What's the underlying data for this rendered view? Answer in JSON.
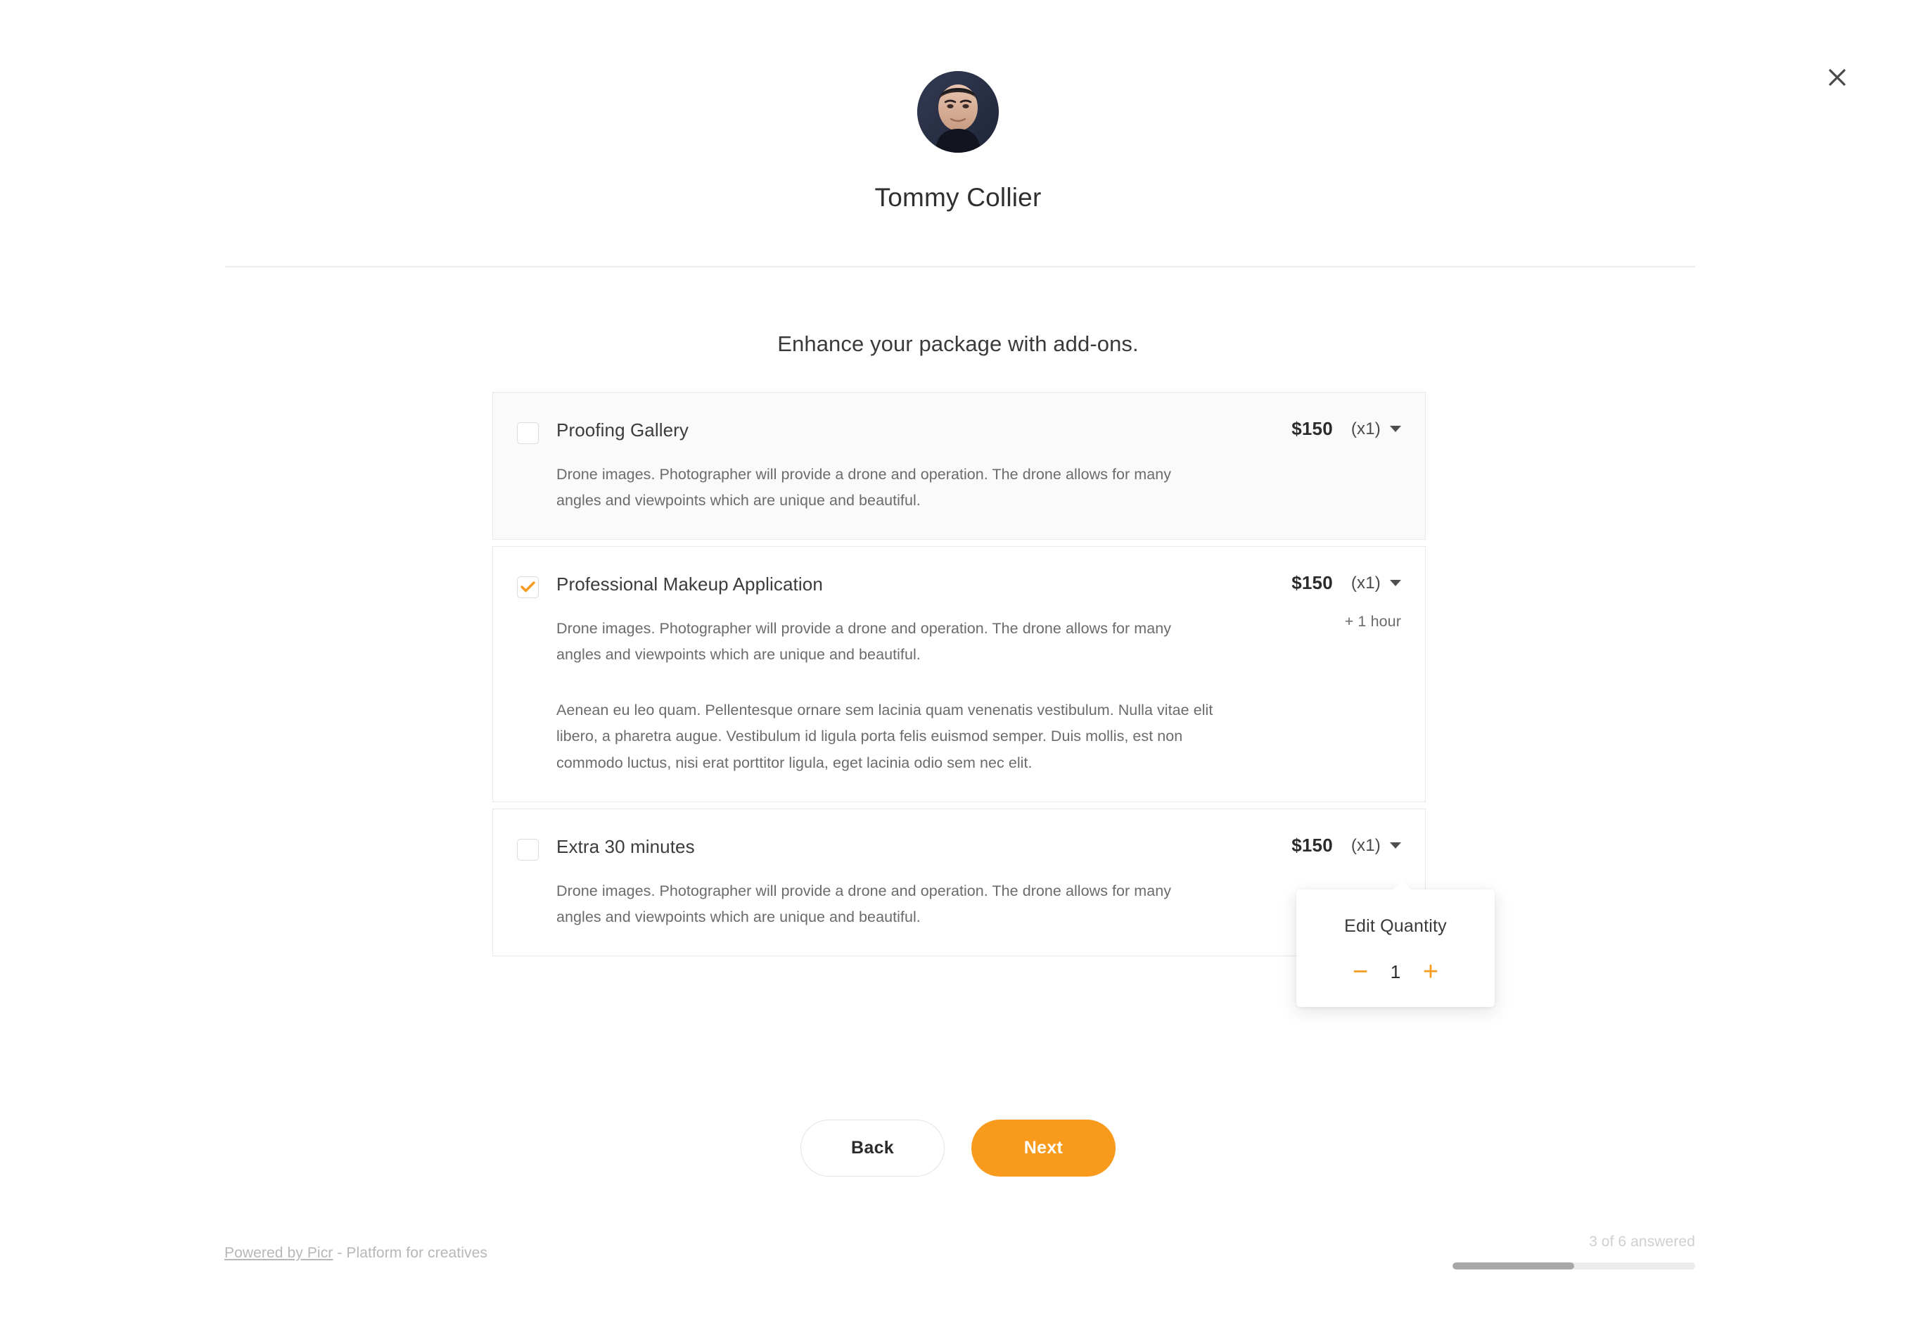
{
  "header": {
    "profile_name": "Tommy Collier",
    "avatar_icon": "user-avatar-photo",
    "close_icon": "close-icon"
  },
  "main": {
    "section_heading": "Enhance your package with add-ons.",
    "addons": [
      {
        "title": "Proofing Gallery",
        "checked": false,
        "price": "$150",
        "quantity_label": "(x1)",
        "duration": "",
        "descriptions": [
          "Drone images. Photographer will provide a drone and operation. The drone allows for many angles and viewpoints which are unique and beautiful."
        ]
      },
      {
        "title": "Professional Makeup Application",
        "checked": true,
        "price": "$150",
        "quantity_label": "(x1)",
        "duration": "+ 1 hour",
        "descriptions": [
          "Drone images. Photographer will provide a drone and operation. The drone allows for many angles and viewpoints which are unique and beautiful.",
          "Aenean eu leo quam. Pellentesque ornare sem lacinia quam venenatis vestibulum. Nulla vitae elit libero, a pharetra augue. Vestibulum id ligula porta felis euismod semper. Duis mollis, est non commodo luctus, nisi erat porttitor ligula, eget lacinia odio sem nec elit."
        ]
      },
      {
        "title": "Extra 30 minutes",
        "checked": false,
        "price": "$150",
        "quantity_label": "(x1)",
        "duration": "",
        "descriptions": [
          "Drone images. Photographer will provide a drone and operation. The drone allows for many angles and viewpoints which are unique and beautiful."
        ]
      }
    ]
  },
  "quantity_popover": {
    "title": "Edit Quantity",
    "decrement_label": "−",
    "increment_label": "+",
    "value": "1"
  },
  "actions": {
    "back_label": "Back",
    "next_label": "Next"
  },
  "footer": {
    "powered_link_text": "Powered by Picr",
    "powered_suffix": " - Platform for creatives",
    "progress_label": "3 of 6 answered",
    "progress_percent": 50
  },
  "colors": {
    "accent": "#F89A1C",
    "text_primary": "#3C3C3C",
    "text_secondary": "#6B6B6B",
    "border": "#E9E9E9",
    "shaded_card": "#FAFAFA",
    "progress_fill": "#A8A8A8"
  }
}
